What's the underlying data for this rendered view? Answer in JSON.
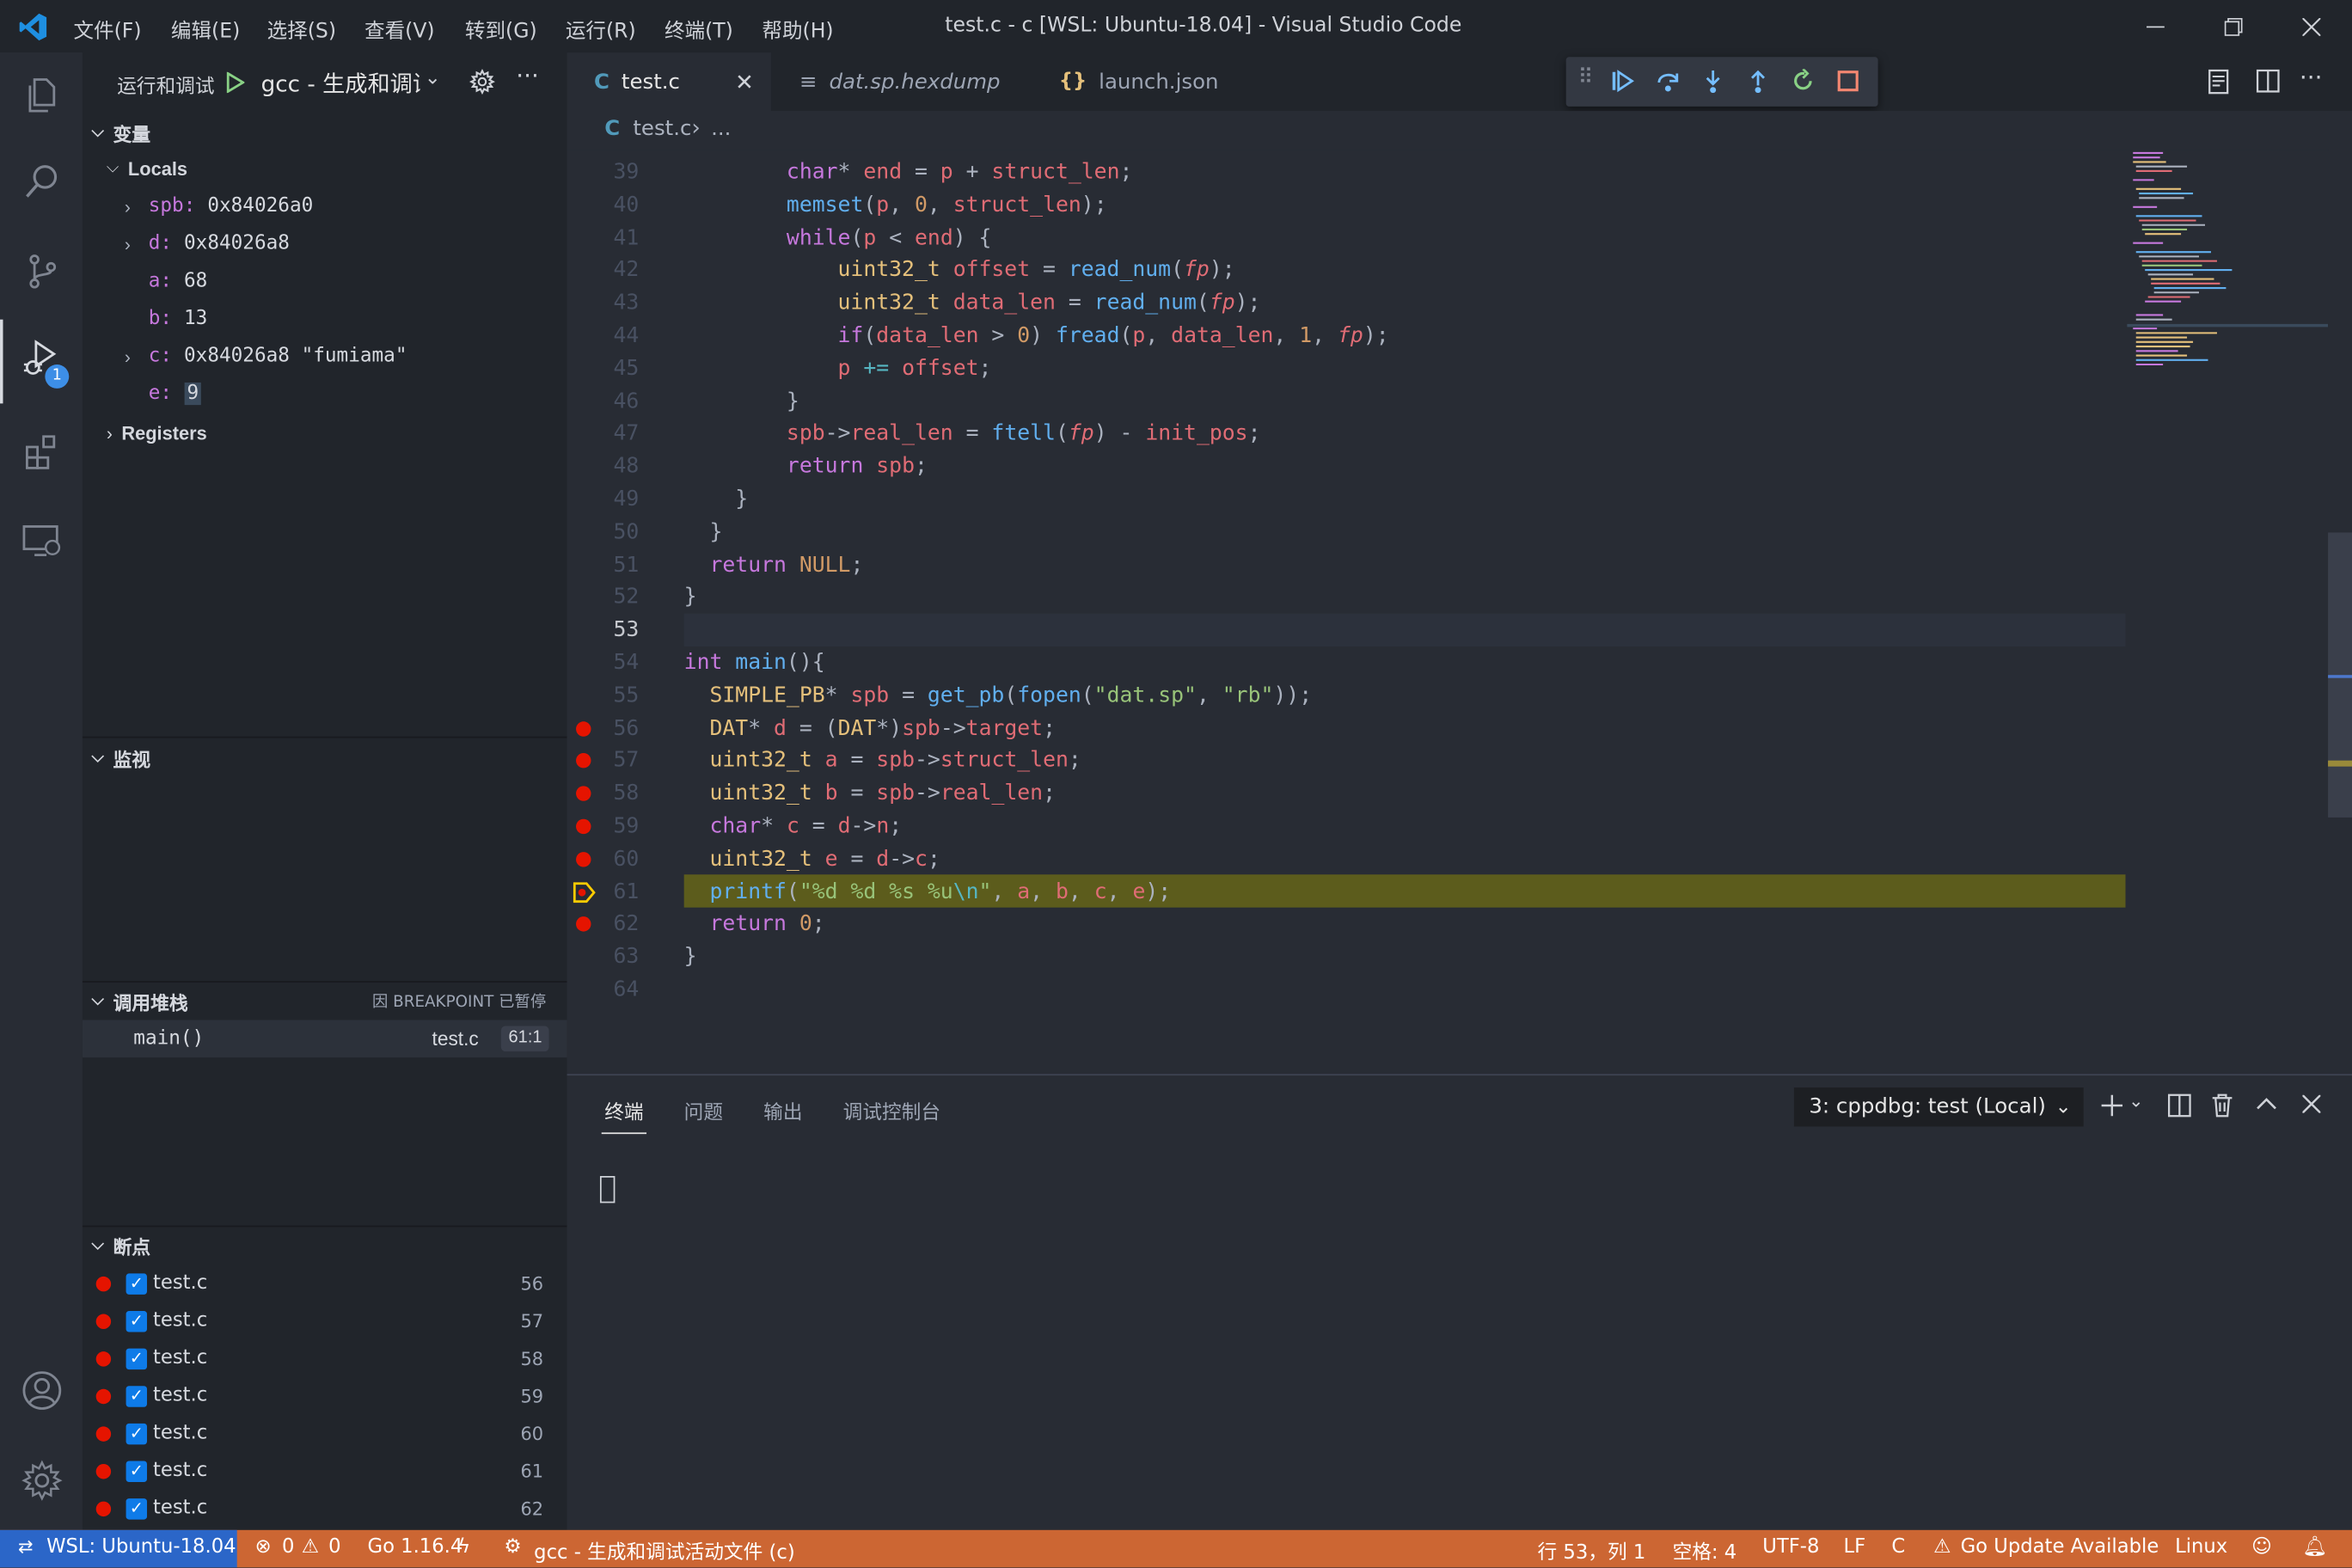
{
  "window": {
    "title": "test.c - c [WSL: Ubuntu-18.04] - Visual Studio Code"
  },
  "menu": [
    "文件(F)",
    "编辑(E)",
    "选择(S)",
    "查看(V)",
    "转到(G)",
    "运行(R)",
    "终端(T)",
    "帮助(H)"
  ],
  "sidebar": {
    "run_label": "运行和调试",
    "config": "gcc - 生成和调试",
    "variables_title": "变量",
    "locals_label": "Locals",
    "locals": [
      {
        "name": "spb:",
        "value": "0x84026a0",
        "expandable": true
      },
      {
        "name": "d:",
        "value": "0x84026a8",
        "expandable": true
      },
      {
        "name": "a:",
        "value": "68",
        "expandable": false
      },
      {
        "name": "b:",
        "value": "13",
        "expandable": false
      },
      {
        "name": "c:",
        "value": "0x84026a8 \"fumiama\"",
        "expandable": true
      },
      {
        "name": "e:",
        "value": "9",
        "expandable": false
      }
    ],
    "registers_label": "Registers",
    "watch_title": "监视",
    "callstack_title": "调用堆栈",
    "callstack_status": "因 BREAKPOINT 已暂停",
    "callstack_frames": [
      {
        "name": "main()",
        "file": "test.c",
        "pos": "61:1"
      }
    ],
    "breakpoints_title": "断点",
    "breakpoints": [
      {
        "file": "test.c",
        "line": "56"
      },
      {
        "file": "test.c",
        "line": "57"
      },
      {
        "file": "test.c",
        "line": "58"
      },
      {
        "file": "test.c",
        "line": "59"
      },
      {
        "file": "test.c",
        "line": "60"
      },
      {
        "file": "test.c",
        "line": "61"
      },
      {
        "file": "test.c",
        "line": "62"
      }
    ]
  },
  "tabs": [
    {
      "icon": "C",
      "label": "test.c",
      "active": true
    },
    {
      "icon": "≡",
      "label": "dat.sp.hexdump",
      "active": false
    },
    {
      "icon": "{}",
      "label": "launch.json",
      "active": false
    }
  ],
  "breadcrumb": {
    "icon": "C",
    "file": "test.c",
    "rest": "..."
  },
  "activity_badge": "1",
  "code": {
    "line_numbers": [
      "39",
      "40",
      "41",
      "42",
      "43",
      "44",
      "45",
      "46",
      "47",
      "48",
      "49",
      "50",
      "51",
      "52",
      "53",
      "54",
      "55",
      "56",
      "57",
      "58",
      "59",
      "60",
      "61",
      "62",
      "63",
      "64"
    ],
    "current_line_index": 14,
    "paused_line_index": 22,
    "breakpoint_line_indices": [
      17,
      18,
      19,
      20,
      21,
      23
    ]
  },
  "panel": {
    "tabs": [
      "终端",
      "问题",
      "输出",
      "调试控制台"
    ],
    "active_tab": "终端",
    "terminal_select": "3: cppdbg: test (Local)"
  },
  "status": {
    "remote": "WSL: Ubuntu-18.04",
    "errors": "0",
    "warnings": "0",
    "go": "Go 1.16.4",
    "debug_config": "gcc - 生成和调试活动文件 (c)",
    "cursor": "行 53，列 1",
    "spaces": "空格: 4",
    "encoding": "UTF-8",
    "eol": "LF",
    "lang": "C",
    "go_update": "Go Update Available",
    "os": "Linux"
  },
  "colors": {
    "accent": "#0e7be8",
    "status_bar": "#cc6633",
    "breakpoint": "#e51400",
    "paused_line": "#5c5c1c"
  }
}
